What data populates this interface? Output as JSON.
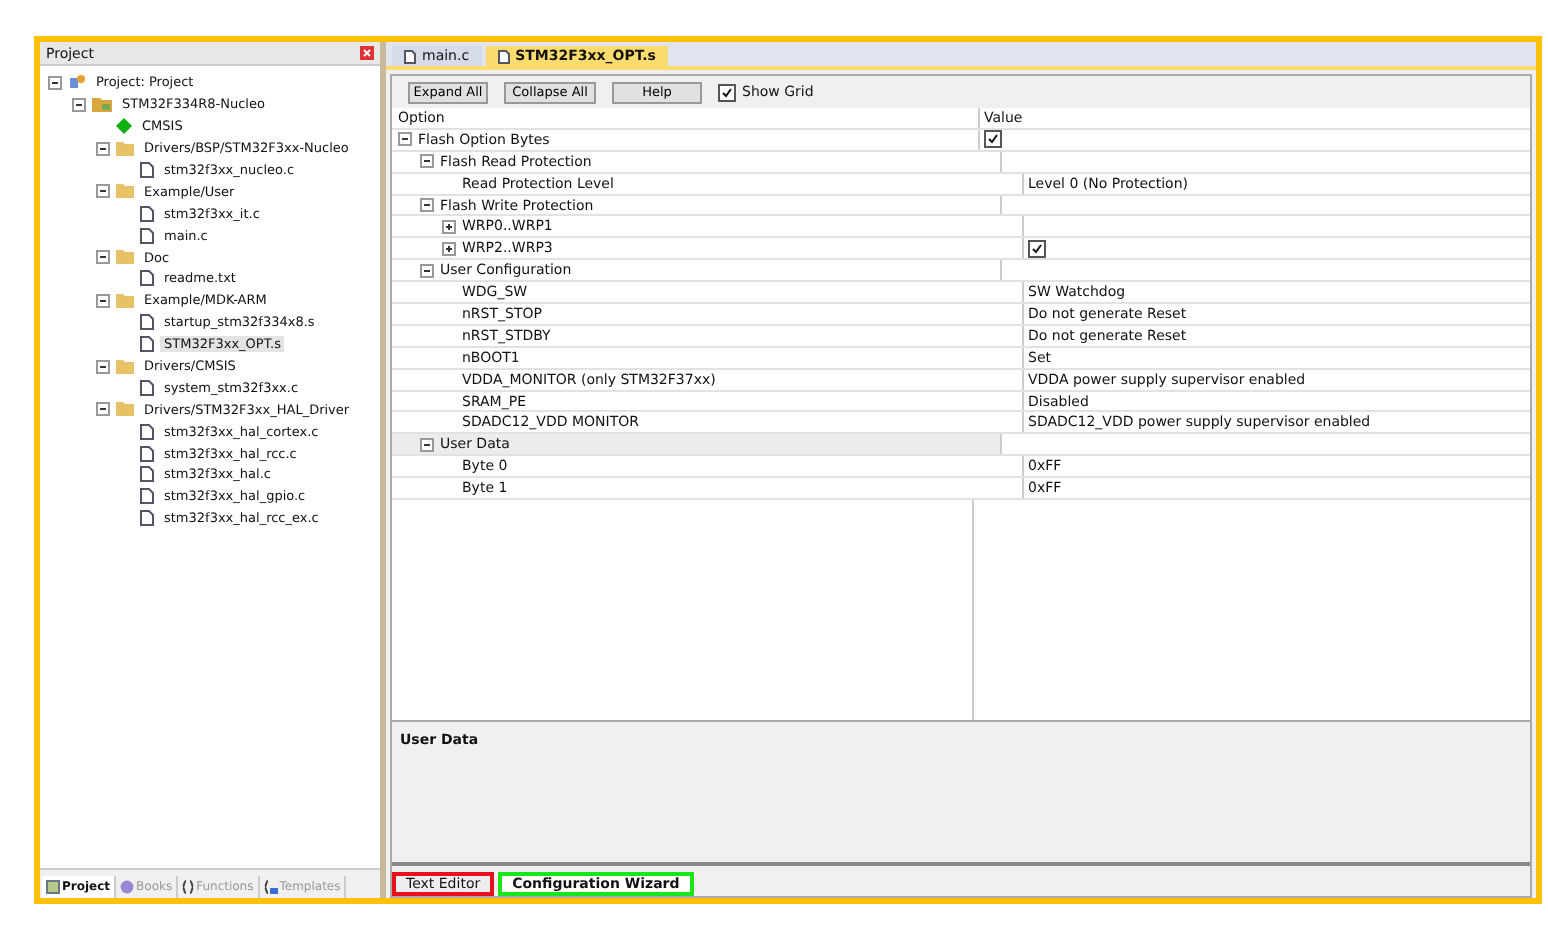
{
  "project_panel": {
    "title": "Project",
    "tree": [
      {
        "label": "Project: Project",
        "kind": "project",
        "expanded": true,
        "selected": false,
        "children": [
          {
            "label": "STM32F334R8-Nucleo",
            "kind": "target",
            "expanded": true,
            "selected": false,
            "children": [
              {
                "label": "CMSIS",
                "kind": "component",
                "selected": false
              },
              {
                "label": "Drivers/BSP/STM32F3xx-Nucleo",
                "kind": "group",
                "expanded": true,
                "selected": false,
                "children": [
                  {
                    "label": "stm32f3xx_nucleo.c",
                    "kind": "file",
                    "selected": false
                  }
                ]
              },
              {
                "label": "Example/User",
                "kind": "group",
                "expanded": true,
                "selected": false,
                "children": [
                  {
                    "label": "stm32f3xx_it.c",
                    "kind": "file",
                    "selected": false
                  },
                  {
                    "label": "main.c",
                    "kind": "file",
                    "selected": false
                  }
                ]
              },
              {
                "label": "Doc",
                "kind": "group",
                "expanded": true,
                "selected": false,
                "children": [
                  {
                    "label": "readme.txt",
                    "kind": "file",
                    "selected": false
                  }
                ]
              },
              {
                "label": "Example/MDK-ARM",
                "kind": "group",
                "expanded": true,
                "selected": false,
                "children": [
                  {
                    "label": "startup_stm32f334x8.s",
                    "kind": "file",
                    "selected": false
                  },
                  {
                    "label": "STM32F3xx_OPT.s",
                    "kind": "file",
                    "selected": true
                  }
                ]
              },
              {
                "label": "Drivers/CMSIS",
                "kind": "group",
                "expanded": true,
                "selected": false,
                "children": [
                  {
                    "label": "system_stm32f3xx.c",
                    "kind": "file",
                    "selected": false
                  }
                ]
              },
              {
                "label": "Drivers/STM32F3xx_HAL_Driver",
                "kind": "group",
                "expanded": true,
                "selected": false,
                "children": [
                  {
                    "label": "stm32f3xx_hal_cortex.c",
                    "kind": "file",
                    "selected": false
                  },
                  {
                    "label": "stm32f3xx_hal_rcc.c",
                    "kind": "file",
                    "selected": false
                  },
                  {
                    "label": "stm32f3xx_hal.c",
                    "kind": "file",
                    "selected": false
                  },
                  {
                    "label": "stm32f3xx_hal_gpio.c",
                    "kind": "file",
                    "selected": false
                  },
                  {
                    "label": "stm32f3xx_hal_rcc_ex.c",
                    "kind": "file",
                    "selected": false
                  }
                ]
              }
            ]
          }
        ]
      }
    ],
    "tabs": [
      {
        "label": "Project",
        "kind": "project",
        "selected": true
      },
      {
        "label": "Books",
        "kind": "books",
        "selected": false
      },
      {
        "label": "Functions",
        "kind": "functions",
        "selected": false
      },
      {
        "label": "Templates",
        "kind": "templates",
        "selected": false
      }
    ]
  },
  "editor_tabs": [
    {
      "label": "main.c",
      "selected": false
    },
    {
      "label": "STM32F3xx_OPT.s",
      "selected": true
    }
  ],
  "toolbar": {
    "buttons": [
      "Expand All",
      "Collapse All",
      "Help"
    ],
    "show_grid": {
      "label": "Show Grid",
      "checked": true
    }
  },
  "grid": {
    "columns": [
      "Option",
      "Value"
    ],
    "rows": [
      {
        "option": "Flash Option Bytes",
        "kind": "checkbox",
        "checked": true,
        "expanded": true,
        "selected": false,
        "children": [
          {
            "option": "Flash Read Protection",
            "expanded": true,
            "selected": false,
            "children": [
              {
                "option": "Read Protection Level",
                "kind": "text",
                "value": "Level 0 (No Protection)",
                "selected": false
              }
            ]
          },
          {
            "option": "Flash Write Protection",
            "expanded": true,
            "selected": false,
            "children": [
              {
                "option": "WRP0..WRP1",
                "expanded": false,
                "selected": false
              },
              {
                "option": "WRP2..WRP3",
                "kind": "checkbox",
                "checked": true,
                "expanded": false,
                "selected": false
              }
            ]
          },
          {
            "option": "User Configuration",
            "expanded": true,
            "selected": false,
            "children": [
              {
                "option": "WDG_SW",
                "kind": "text",
                "value": "SW Watchdog",
                "selected": false
              },
              {
                "option": "nRST_STOP",
                "kind": "text",
                "value": "Do not generate Reset",
                "selected": false
              },
              {
                "option": "nRST_STDBY",
                "kind": "text",
                "value": "Do not generate Reset",
                "selected": false
              },
              {
                "option": "nBOOT1",
                "kind": "text",
                "value": "Set",
                "selected": false
              },
              {
                "option": "VDDA_MONITOR (only STM32F37xx)",
                "kind": "text",
                "value": "VDDA power supply supervisor enabled",
                "selected": false
              },
              {
                "option": "SRAM_PE",
                "kind": "text",
                "value": "Disabled",
                "selected": false
              },
              {
                "option": "SDADC12_VDD MONITOR",
                "kind": "text",
                "value": "SDADC12_VDD power supply supervisor enabled",
                "selected": false
              }
            ]
          },
          {
            "option": "User Data",
            "expanded": true,
            "selected": true,
            "children": [
              {
                "option": "Byte 0",
                "kind": "text",
                "value": "0xFF",
                "selected": false
              },
              {
                "option": "Byte 1",
                "kind": "text",
                "value": "0xFF",
                "selected": false
              }
            ]
          }
        ]
      }
    ]
  },
  "description": {
    "title": "User Data"
  },
  "bottom_tabs": [
    {
      "label": "Text Editor",
      "selected": false,
      "color": "#e8101c"
    },
    {
      "label": "Configuration Wizard",
      "selected": true,
      "color": "#19e619"
    }
  ]
}
